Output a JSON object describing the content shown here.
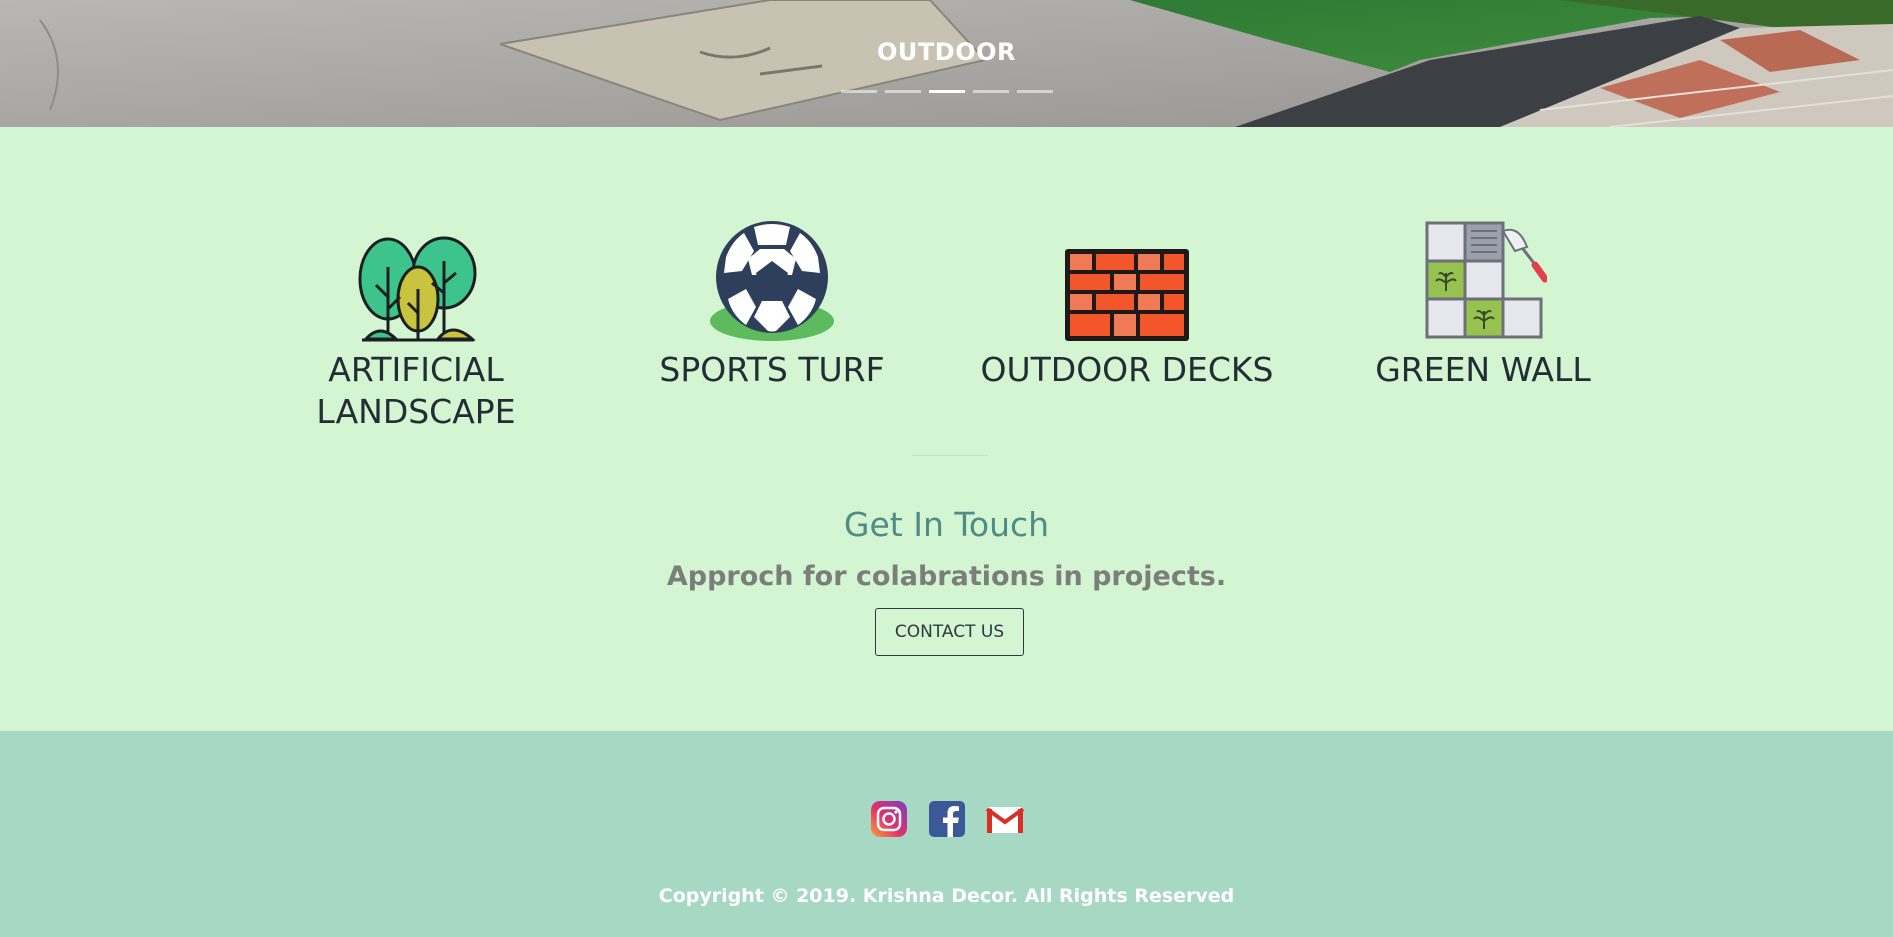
{
  "hero": {
    "caption": "OUTDOOR",
    "indicators": 5,
    "active_indicator": 3
  },
  "services": [
    {
      "title": "ARTIFICIAL LANDSCAPE",
      "icon": "trees-icon"
    },
    {
      "title": "SPORTS TURF",
      "icon": "soccer-ball-icon"
    },
    {
      "title": "OUTDOOR DECKS",
      "icon": "brick-wall-icon"
    },
    {
      "title": "GREEN WALL",
      "icon": "green-wall-tiles-icon"
    }
  ],
  "contact": {
    "title": "Get In Touch",
    "subtitle": "Approch for colabrations in projects.",
    "button_label": "CONTACT US"
  },
  "footer": {
    "social": [
      {
        "name": "Instagram",
        "icon": "instagram-icon"
      },
      {
        "name": "Facebook",
        "icon": "facebook-icon"
      },
      {
        "name": "Gmail",
        "icon": "gmail-icon"
      }
    ],
    "copyright": "Copyright © 2019. Krishna Decor. All Rights Reserved"
  },
  "colors": {
    "section_bg": "#d4f5d1",
    "footer_bg": "#a6d8c4",
    "heading_accent": "#4e8c86"
  }
}
